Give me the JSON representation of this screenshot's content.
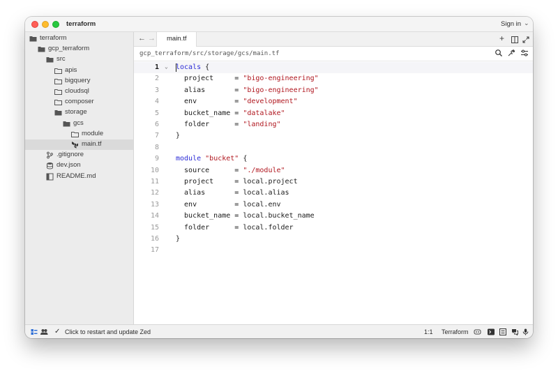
{
  "window": {
    "title": "terraform",
    "sign_in_label": "Sign in"
  },
  "sidebar": {
    "items": [
      {
        "label": "terraform",
        "icon": "folder-open-icon"
      },
      {
        "label": "gcp_terraform",
        "icon": "folder-open-icon"
      },
      {
        "label": "src",
        "icon": "folder-open-icon"
      },
      {
        "label": "apis",
        "icon": "folder-icon"
      },
      {
        "label": "bigquery",
        "icon": "folder-icon"
      },
      {
        "label": "cloudsql",
        "icon": "folder-icon"
      },
      {
        "label": "composer",
        "icon": "folder-icon"
      },
      {
        "label": "storage",
        "icon": "folder-open-icon"
      },
      {
        "label": "gcs",
        "icon": "folder-open-icon"
      },
      {
        "label": "module",
        "icon": "folder-icon"
      },
      {
        "label": "main.tf",
        "icon": "terraform-file-icon",
        "selected": true
      },
      {
        "label": ".gitignore",
        "icon": "git-icon"
      },
      {
        "label": "dev.json",
        "icon": "database-icon"
      },
      {
        "label": "README.md",
        "icon": "book-icon"
      }
    ]
  },
  "tabs": [
    {
      "label": "main.tf",
      "active": true
    }
  ],
  "breadcrumb": "gcp_terraform/src/storage/gcs/main.tf",
  "editor": {
    "active_line": 1,
    "lines": [
      {
        "n": "1",
        "text": "locals {"
      },
      {
        "n": "2",
        "text": "  project     = \"bigo-engineering\""
      },
      {
        "n": "3",
        "text": "  alias       = \"bigo-engineering\""
      },
      {
        "n": "4",
        "text": "  env         = \"development\""
      },
      {
        "n": "5",
        "text": "  bucket_name = \"datalake\""
      },
      {
        "n": "6",
        "text": "  folder      = \"landing\""
      },
      {
        "n": "7",
        "text": "}"
      },
      {
        "n": "8",
        "text": ""
      },
      {
        "n": "9",
        "text": "module \"bucket\" {"
      },
      {
        "n": "10",
        "text": "  source      = \"./module\""
      },
      {
        "n": "11",
        "text": "  project     = local.project"
      },
      {
        "n": "12",
        "text": "  alias       = local.alias"
      },
      {
        "n": "13",
        "text": "  env         = local.env"
      },
      {
        "n": "14",
        "text": "  bucket_name = local.bucket_name"
      },
      {
        "n": "15",
        "text": "  folder      = local.folder"
      },
      {
        "n": "16",
        "text": "}"
      },
      {
        "n": "17",
        "text": ""
      }
    ]
  },
  "status": {
    "update_message": "Click to restart and update Zed",
    "cursor_position": "1:1",
    "language": "Terraform"
  },
  "colors": {
    "keyword": "#2b2bd6",
    "string": "#b0171f",
    "sidebar_bg": "#ececec",
    "selection_bg": "#dadada"
  }
}
